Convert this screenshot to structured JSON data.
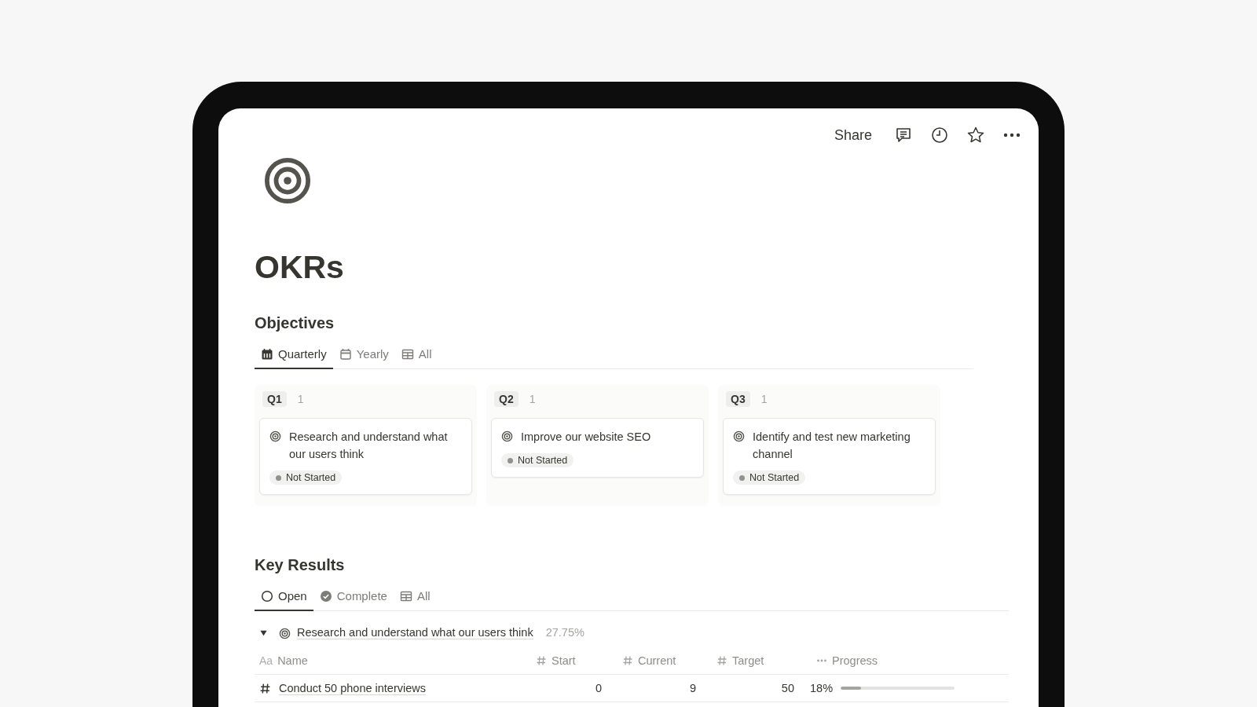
{
  "topbar": {
    "share": "Share"
  },
  "page": {
    "title": "OKRs"
  },
  "objectives": {
    "heading": "Objectives",
    "tabs": [
      {
        "label": "Quarterly",
        "kind": "board",
        "selected": true
      },
      {
        "label": "Yearly",
        "kind": "calendar",
        "selected": false
      },
      {
        "label": "All",
        "kind": "table",
        "selected": false
      }
    ],
    "columns": [
      {
        "label": "Q1",
        "count": "1",
        "cards": [
          {
            "title": "Research and understand what our users think",
            "status": "Not Started",
            "color": "#91918e"
          }
        ]
      },
      {
        "label": "Q2",
        "count": "1",
        "cards": [
          {
            "title": "Improve our website SEO",
            "status": "Not Started",
            "color": "#91918e"
          }
        ]
      },
      {
        "label": "Q3",
        "count": "1",
        "cards": [
          {
            "title": "Identify and test new marketing channel",
            "status": "Not Started",
            "color": "#91918e"
          }
        ]
      }
    ]
  },
  "key_results": {
    "heading": "Key Results",
    "tabs": [
      {
        "label": "Open",
        "kind": "circle",
        "selected": true
      },
      {
        "label": "Complete",
        "kind": "check",
        "selected": false
      },
      {
        "label": "All",
        "kind": "table",
        "selected": false
      }
    ],
    "group": {
      "title": "Research and understand what our users think",
      "percent": "27.75%",
      "expanded": true
    },
    "columns": [
      {
        "label": "Name",
        "kind": "title",
        "type_label": "Aa"
      },
      {
        "label": "Start",
        "kind": "number"
      },
      {
        "label": "Current",
        "kind": "number"
      },
      {
        "label": "Target",
        "kind": "number"
      },
      {
        "label": "Progress",
        "kind": "formula"
      }
    ],
    "rows": [
      {
        "name": "Conduct 50 phone interviews",
        "start": "0",
        "current": "9",
        "target": "50",
        "percent": "18%",
        "level": 0.18
      }
    ]
  }
}
